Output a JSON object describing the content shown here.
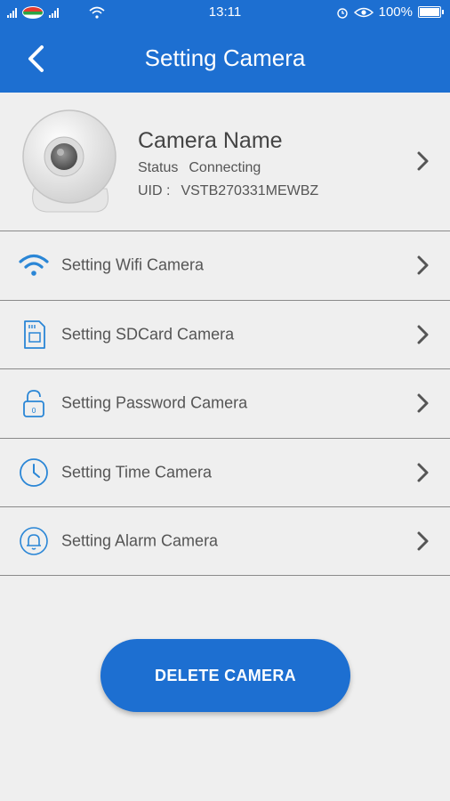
{
  "status_bar": {
    "time": "13:11",
    "battery": "100%",
    "battery_level": 1.0
  },
  "app_bar": {
    "title": "Setting Camera",
    "back_icon": "chevron-left-icon"
  },
  "camera": {
    "name": "Camera Name",
    "status_label": "Status",
    "status_value": "Connecting",
    "uid_label": "UID :",
    "uid_value": "VSTB270331MEWBZ"
  },
  "menu": [
    {
      "label": "Setting Wifi Camera",
      "icon": "wifi-icon"
    },
    {
      "label": "Setting SDCard Camera",
      "icon": "sdcard-icon"
    },
    {
      "label": "Setting Password Camera",
      "icon": "lock-icon"
    },
    {
      "label": "Setting Time Camera",
      "icon": "clock-icon"
    },
    {
      "label": "Setting Alarm Camera",
      "icon": "bell-icon"
    }
  ],
  "delete_button": "DELETE CAMERA",
  "colors": {
    "primary": "#1d6fd1",
    "background": "#efefef",
    "icon_blue": "#2a86d6"
  }
}
